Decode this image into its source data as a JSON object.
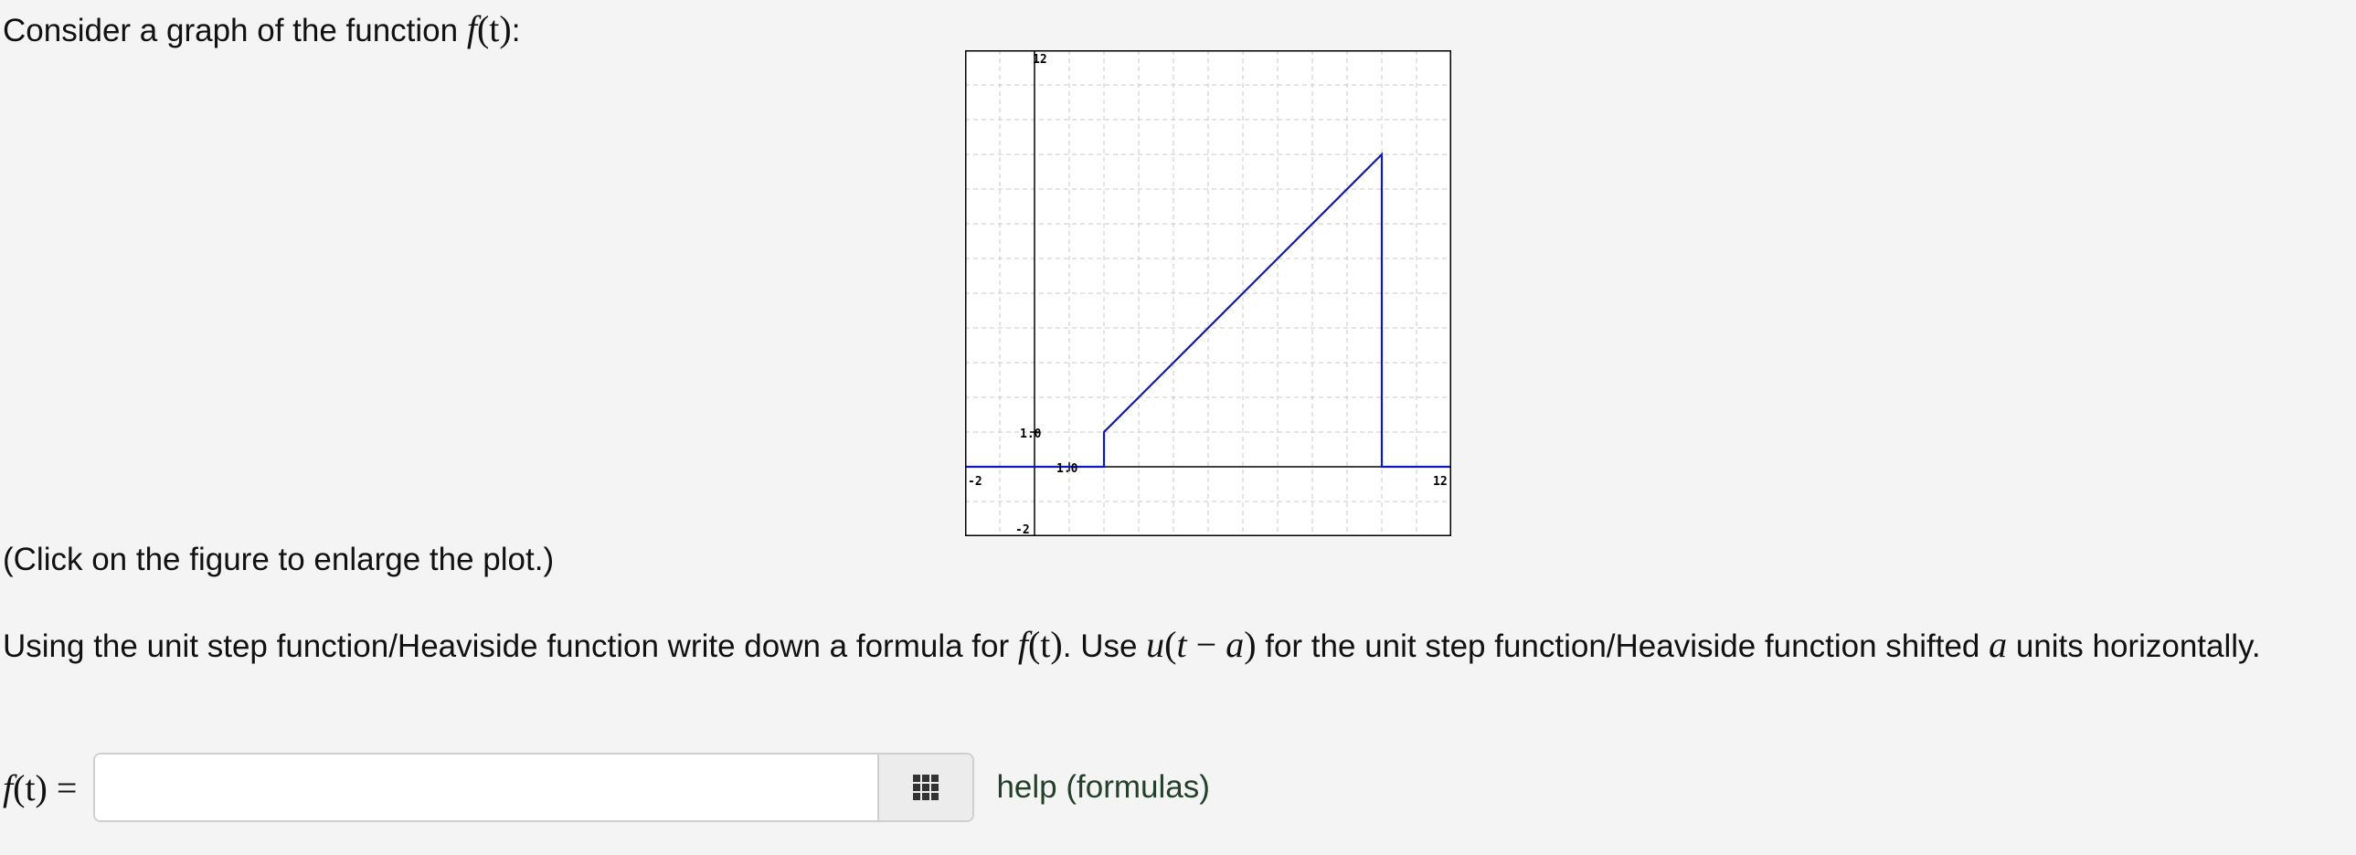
{
  "intro": {
    "text": "Consider a graph of the function ",
    "func": "f",
    "arg": "(t)",
    "tail": ":"
  },
  "click_note": "(Click on the figure to enlarge the plot.)",
  "question": {
    "part1": "Using the unit step function/Heaviside function write down a formula for ",
    "func": "f",
    "arg": "(t)",
    "part2": ". Use ",
    "u": "u",
    "u_arg_open": "(",
    "u_t": "t",
    "u_minus": " − ",
    "u_a": "a",
    "u_arg_close": ")",
    "part3": " for the unit step function/Heaviside function shifted ",
    "a": "a",
    "part4": " units horizontally."
  },
  "answer": {
    "label_func": "f",
    "label_arg": "(t)",
    "label_eq": " =",
    "value": "",
    "placeholder": ""
  },
  "palette_icon": "grid-icon",
  "help_link": "help (formulas)",
  "colors": {
    "curve": "#0b18c4",
    "grid": "#c8c8c8",
    "axis": "#000000",
    "background": "#f4f4f4"
  },
  "chart_data": {
    "type": "line",
    "xlim": [
      -2,
      12
    ],
    "ylim": [
      -2,
      12
    ],
    "grid": true,
    "grid_step": 1,
    "tick_labels": {
      "x_min": "-2",
      "x_max": "12",
      "y_min": "-2",
      "y_max": "12",
      "x_unit": "1.0",
      "y_unit": "1.0"
    },
    "series": [
      {
        "x": [
          -2,
          2,
          2,
          10,
          10,
          12
        ],
        "y": [
          0,
          0,
          1,
          9,
          0,
          0
        ]
      }
    ]
  }
}
